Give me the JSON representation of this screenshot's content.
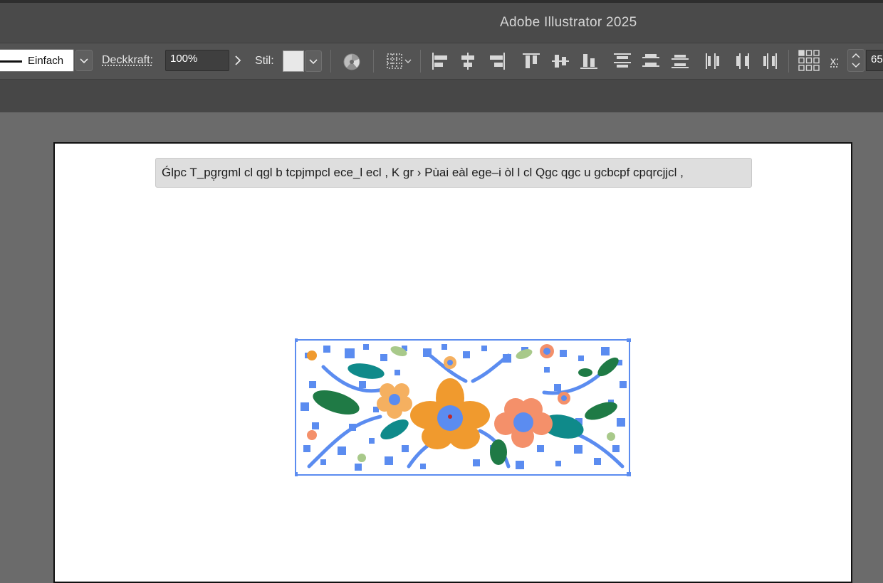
{
  "app": {
    "title": "Adobe Illustrator 2025"
  },
  "control_bar": {
    "stroke_style": "Einfach",
    "opacity_label": "Deckkraft:",
    "opacity_value": "100%",
    "style_label": "Stil:",
    "x_label": "x:",
    "x_value": "65"
  },
  "canvas": {
    "banner_text": "Ǵlpc T_pg̣rgml cl qgl b tcpjmpcl ece_l ecl , K gr › Pùai eàl ege–i òl l cl  Qgc qgc u gcbcpf cpqrcjjcl ,"
  },
  "colors": {
    "selection": "#5b8cf0",
    "leaf_dark": "#1f7a45",
    "leaf_teal": "#0f8a8a",
    "flower_orange": "#f09a2e",
    "flower_salmon": "#f4906a",
    "flower_light": "#f5b060"
  },
  "icons": [
    "chevron-down-icon",
    "chevron-right-icon",
    "recolor-icon",
    "grid-icon",
    "align-left-icon",
    "align-hcenter-icon",
    "align-right-icon",
    "align-top-icon",
    "align-vcenter-icon",
    "align-bottom-icon",
    "distribute-top-icon",
    "distribute-vcenter-icon",
    "distribute-bottom-icon",
    "distribute-left-icon",
    "distribute-hcenter-icon",
    "distribute-right-icon",
    "reference-point-icon",
    "stepper-icon"
  ]
}
